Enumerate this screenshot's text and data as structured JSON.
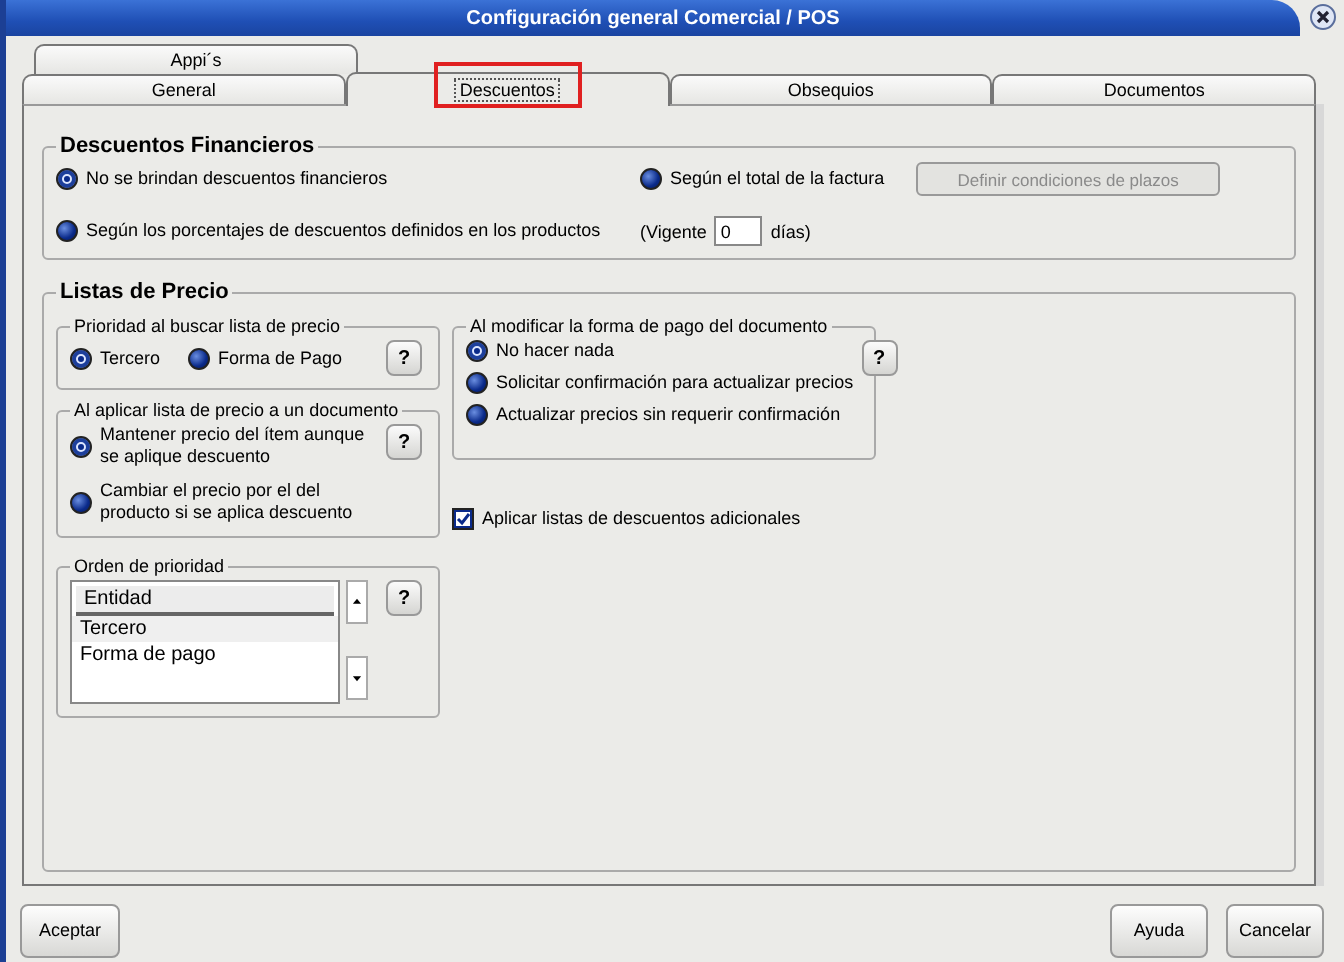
{
  "window": {
    "title": "Configuración general Comercial / POS"
  },
  "tabs": [
    [
      {
        "label": "Appi´s",
        "selected": false,
        "highlighted": false
      }
    ],
    [
      {
        "label": "General",
        "selected": false,
        "highlighted": false
      },
      {
        "label": "Descuentos",
        "selected": true,
        "highlighted": true
      },
      {
        "label": "Obsequios",
        "selected": false,
        "highlighted": false
      },
      {
        "label": "Documentos",
        "selected": false,
        "highlighted": false
      }
    ]
  ],
  "financial": {
    "title": "Descuentos Financieros",
    "options": [
      {
        "label": "No se brindan descuentos financieros",
        "selected": true
      },
      {
        "label": "Según el total de la factura",
        "selected": false
      },
      {
        "label": "Según los porcentajes de descuentos definidos en los productos",
        "selected": false
      }
    ],
    "button": {
      "label": "Definir condiciones de plazos",
      "disabled": true
    },
    "validity": {
      "prefix": "(Vigente",
      "value": "0",
      "suffix": "días)"
    }
  },
  "price_lists": {
    "title": "Listas de Precio",
    "search_priority": {
      "title": "Prioridad al buscar lista de precio",
      "help": "?",
      "options": [
        {
          "label": "Tercero",
          "selected": true
        },
        {
          "label": "Forma de Pago",
          "selected": false
        }
      ]
    },
    "apply_list": {
      "title": "Al aplicar lista de precio a un documento",
      "help": "?",
      "options": [
        {
          "label": "Mantener precio del ítem aunque se aplique descuento",
          "selected": true
        },
        {
          "label": "Cambiar el precio por el del producto si se aplica descuento",
          "selected": false
        }
      ]
    },
    "priority_order": {
      "title": "Orden de prioridad",
      "help": "?",
      "column": "Entidad",
      "rows": [
        {
          "label": "Tercero",
          "selected": true
        },
        {
          "label": "Forma de pago",
          "selected": false
        }
      ]
    },
    "modify_payment": {
      "title": "Al modificar la forma de pago del documento",
      "help": "?",
      "options": [
        {
          "label": "No hacer nada",
          "selected": true
        },
        {
          "label": "Solicitar confirmación para actualizar precios",
          "selected": false
        },
        {
          "label": "Actualizar precios sin requerir confirmación",
          "selected": false
        }
      ]
    },
    "extra_discounts": {
      "label": "Aplicar listas de descuentos adicionales",
      "checked": true
    }
  },
  "buttons_left": [
    {
      "label": "Aceptar"
    }
  ],
  "buttons_right": [
    {
      "label": "Ayuda"
    },
    {
      "label": "Cancelar"
    }
  ]
}
